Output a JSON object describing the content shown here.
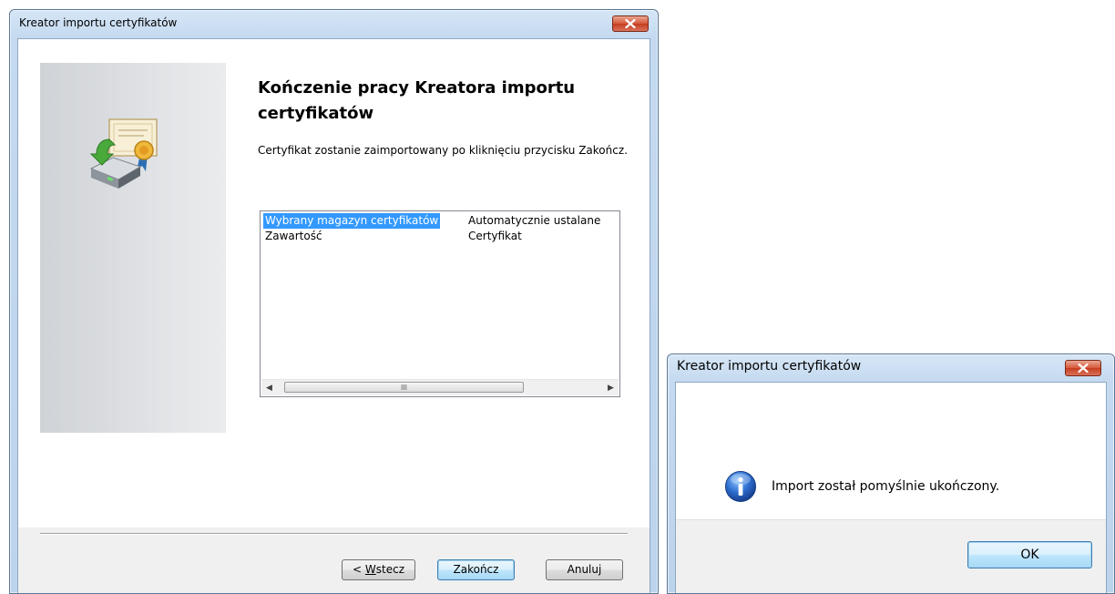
{
  "wizard": {
    "title": "Kreator importu certyfikatów",
    "heading": "Kończenie pracy Kreatora importu certyfikatów",
    "description": "Certyfikat zostanie zaimportowany po kliknięciu przycisku Zakończ.",
    "summary": [
      {
        "key": "Wybrany magazyn certyfikatów",
        "value": "Automatycznie ustalane",
        "selected": true
      },
      {
        "key": "Zawartość",
        "value": "Certyfikat",
        "selected": false
      }
    ],
    "scrollbar_grip": "III",
    "buttons": {
      "back_prefix": "< ",
      "back_mnemonic": "W",
      "back_rest": "stecz",
      "finish": "Zakończ",
      "cancel": "Anuluj"
    }
  },
  "message_box": {
    "title": "Kreator importu certyfikatów",
    "message": "Import został pomyślnie ukończony.",
    "ok": "OK"
  },
  "icons": {
    "wizard_image": "certificate-import-icon",
    "info": "info-icon",
    "close": "close-icon"
  },
  "colors": {
    "selection": "#3399ff",
    "close_button": "#c63d1f",
    "title_bar": "#c5daf0"
  }
}
